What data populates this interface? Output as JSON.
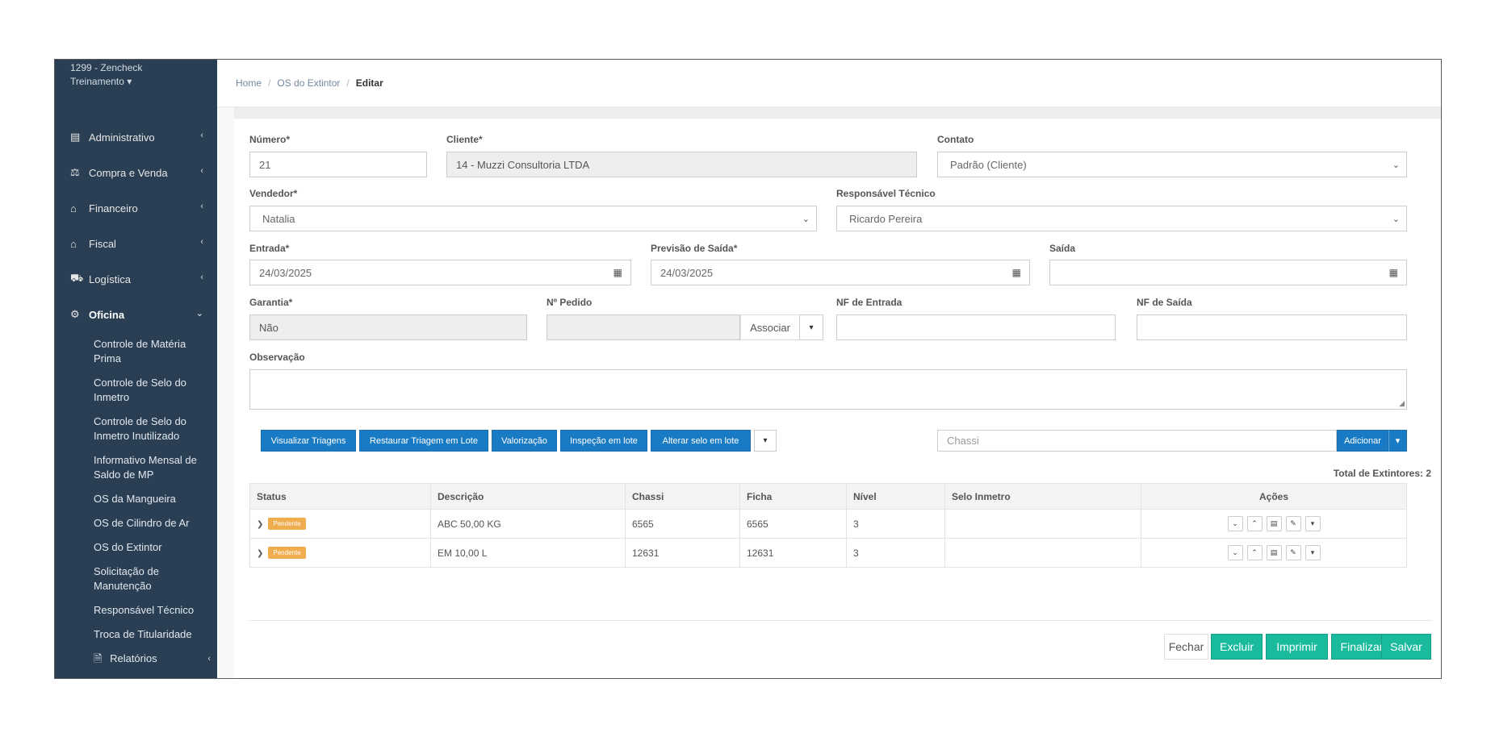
{
  "sidebar": {
    "brand_line1": "1299 - Zencheck",
    "brand_line2": "Treinamento ▾",
    "items": [
      {
        "label": "Administrativo",
        "icon": "list-icon"
      },
      {
        "label": "Compra e Venda",
        "icon": "balance-scale-icon"
      },
      {
        "label": "Financeiro",
        "icon": "bank-icon"
      },
      {
        "label": "Fiscal",
        "icon": "bank-icon"
      },
      {
        "label": "Logística",
        "icon": "truck-icon"
      },
      {
        "label": "Oficina",
        "icon": "cogs-icon"
      }
    ],
    "sub": [
      "Controle de Matéria Prima",
      "Controle de Selo do Inmetro",
      "Controle de Selo do Inmetro Inutilizado",
      "Informativo Mensal de Saldo de MP",
      "OS da Mangueira",
      "OS de Cilindro de Ar",
      "OS do Extintor",
      "Solicitação de Manutenção",
      "Responsável Técnico",
      "Troca de Titularidade",
      "Relatórios"
    ]
  },
  "breadcrumb": {
    "home": "Home",
    "section": "OS do Extintor",
    "current": "Editar"
  },
  "form": {
    "numero": {
      "label": "Número*",
      "value": "21"
    },
    "cliente": {
      "label": "Cliente*",
      "value": "14 - Muzzi Consultoria LTDA"
    },
    "contato": {
      "label": "Contato",
      "value": "Padrão (Cliente)"
    },
    "vendedor": {
      "label": "Vendedor*",
      "value": "Natalia"
    },
    "responsavel": {
      "label": "Responsável Técnico",
      "value": "Ricardo Pereira"
    },
    "entrada": {
      "label": "Entrada*",
      "value": "24/03/2025"
    },
    "previsao": {
      "label": "Previsão de Saída*",
      "value": "24/03/2025"
    },
    "saida": {
      "label": "Saída",
      "value": ""
    },
    "garantia": {
      "label": "Garantia*",
      "value": "Não"
    },
    "pedido": {
      "label": "Nº Pedido",
      "value": "",
      "button": "Associar"
    },
    "nf_entrada": {
      "label": "NF de Entrada",
      "value": ""
    },
    "nf_saida": {
      "label": "NF de Saída",
      "value": ""
    },
    "observacao": {
      "label": "Observação",
      "value": ""
    }
  },
  "toolbar": {
    "buttons": [
      "Visualizar Triagens",
      "Restaurar Triagem em Lote",
      "Valorização",
      "Inspeção em lote",
      "Alterar selo em lote"
    ],
    "chassi_placeholder": "Chassi",
    "add_label": "Adicionar",
    "total": "Total de Extintores: 2"
  },
  "table": {
    "headers": [
      "Status",
      "Descrição",
      "Chassi",
      "Ficha",
      "Nível",
      "Selo Inmetro",
      "Ações"
    ],
    "rows": [
      {
        "status": "Pendente",
        "descricao": "ABC 50,00 KG",
        "chassi": "6565",
        "ficha": "6565",
        "nivel": "3",
        "selo": ""
      },
      {
        "status": "Pendente",
        "descricao": "EM 10,00 L",
        "chassi": "12631",
        "ficha": "12631",
        "nivel": "3",
        "selo": ""
      }
    ]
  },
  "footer": {
    "fechar": "Fechar",
    "excluir": "Excluir",
    "imprimir": "Imprimir",
    "finalizar": "Finalizar",
    "salvar": "Salvar"
  },
  "colors": {
    "sidebar": "#2a3f54",
    "primary": "#1a7bc5",
    "success": "#1abb9c",
    "badge": "#f0ad4e"
  }
}
